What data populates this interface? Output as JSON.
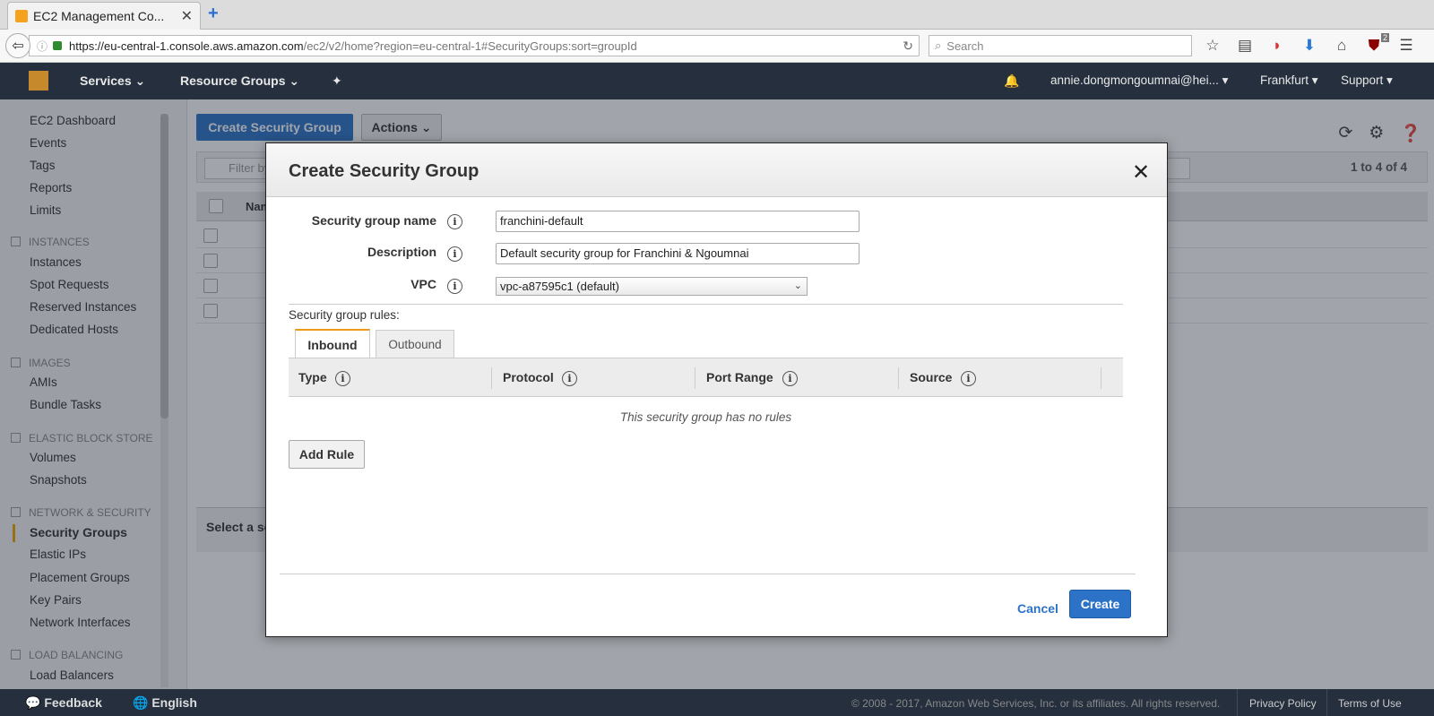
{
  "browser": {
    "tab_title": "EC2 Management Co...",
    "new_tab": "+",
    "url_host": "https://eu-central-1.console.aws.amazon.com",
    "url_path": "/ec2/v2/home?region=eu-central-1#SecurityGroups:sort=groupId",
    "search_placeholder": "Search",
    "badge_count": "2"
  },
  "awsnav": {
    "services": "Services",
    "resource_groups": "Resource Groups",
    "user": "annie.dongmongoumnai@hei...",
    "region": "Frankfurt",
    "support": "Support"
  },
  "sidebar": {
    "top_links": [
      "EC2 Dashboard",
      "Events",
      "Tags",
      "Reports",
      "Limits"
    ],
    "sections": [
      {
        "title": "INSTANCES",
        "items": [
          "Instances",
          "Spot Requests",
          "Reserved Instances",
          "Dedicated Hosts"
        ]
      },
      {
        "title": "IMAGES",
        "items": [
          "AMIs",
          "Bundle Tasks"
        ]
      },
      {
        "title": "ELASTIC BLOCK STORE",
        "items": [
          "Volumes",
          "Snapshots"
        ]
      },
      {
        "title": "NETWORK & SECURITY",
        "items": [
          "Security Groups",
          "Elastic IPs",
          "Placement Groups",
          "Key Pairs",
          "Network Interfaces"
        ]
      },
      {
        "title": "LOAD BALANCING",
        "items": [
          "Load Balancers"
        ]
      }
    ],
    "active_item": "Security Groups"
  },
  "main": {
    "create_button": "Create Security Group",
    "actions_button": "Actions",
    "filter_placeholder": "Filter by",
    "pager": "1 to 4 of 4",
    "name_col": "Name",
    "select_label": "Select a security group"
  },
  "modal": {
    "title": "Create Security Group",
    "fields": {
      "name_label": "Security group name",
      "name_value": "franchini-default",
      "desc_label": "Description",
      "desc_value": "Default security group for Franchini & Ngoumnai",
      "vpc_label": "VPC",
      "vpc_value": "vpc-a87595c1 (default)"
    },
    "rules_label": "Security group rules:",
    "tabs": {
      "inbound": "Inbound",
      "outbound": "Outbound"
    },
    "columns": {
      "type": "Type",
      "protocol": "Protocol",
      "port_range": "Port Range",
      "source": "Source"
    },
    "no_rules": "This security group has no rules",
    "add_rule": "Add Rule",
    "cancel": "Cancel",
    "create": "Create"
  },
  "footer": {
    "feedback": "Feedback",
    "language": "English",
    "copyright": "© 2008 - 2017, Amazon Web Services, Inc. or its affiliates. All rights reserved.",
    "privacy": "Privacy Policy",
    "terms": "Terms of Use"
  },
  "colors": {
    "aws_nav": "#252f3e",
    "primary_blue": "#2c72c7",
    "active_accent": "#f0a500"
  }
}
